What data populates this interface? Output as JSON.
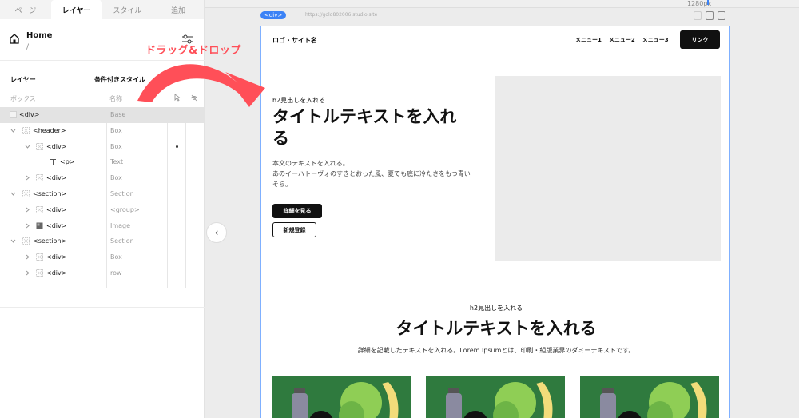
{
  "tabs": [
    {
      "label": "ページ",
      "active": false
    },
    {
      "label": "レイヤー",
      "active": true
    },
    {
      "label": "スタイル",
      "active": false
    },
    {
      "label": "追加",
      "active": false
    }
  ],
  "page": {
    "name": "Home",
    "path": "/"
  },
  "layers_panel": {
    "title": "レイヤー",
    "conditional_style": "条件付きスタイル",
    "column_box": "ボックス",
    "column_name": "名称"
  },
  "tree": [
    {
      "tag": "<div>",
      "type": "Base",
      "depth": 0,
      "selected": true,
      "chevron": false,
      "dot": false
    },
    {
      "tag": "<header>",
      "type": "Box",
      "depth": 1,
      "selected": false,
      "chevron": "down",
      "dot": false
    },
    {
      "tag": "<div>",
      "type": "Box",
      "depth": 2,
      "selected": false,
      "chevron": "down",
      "dot": true
    },
    {
      "tag": "<p>",
      "type": "Text",
      "depth": 3,
      "selected": false,
      "chevron": false,
      "dot": false,
      "text_node": true
    },
    {
      "tag": "<div>",
      "type": "Box",
      "depth": 2,
      "selected": false,
      "chevron": "right",
      "dot": false
    },
    {
      "tag": "<section>",
      "type": "Section",
      "depth": 1,
      "selected": false,
      "chevron": "down",
      "dot": false
    },
    {
      "tag": "<div>",
      "type": "<group>",
      "depth": 2,
      "selected": false,
      "chevron": "right",
      "dot": false
    },
    {
      "tag": "<div>",
      "type": "Image",
      "depth": 2,
      "selected": false,
      "chevron": "right",
      "dot": false,
      "image_node": true
    },
    {
      "tag": "<section>",
      "type": "Section",
      "depth": 1,
      "selected": false,
      "chevron": "down",
      "dot": false
    },
    {
      "tag": "<div>",
      "type": "Box",
      "depth": 2,
      "selected": false,
      "chevron": "right",
      "dot": false
    },
    {
      "tag": "<div>",
      "type": "row",
      "depth": 2,
      "selected": false,
      "chevron": "right",
      "dot": false
    }
  ],
  "annotation": {
    "drag_drop_label": "ドラッグ&ドロップ",
    "color": "#ff4f58"
  },
  "canvas": {
    "width_label": "1280px",
    "selected_badge": "<div>",
    "url": "https://gold802006.studio.site"
  },
  "site": {
    "logo": "ロゴ・サイト名",
    "nav": [
      "メニュー1",
      "メニュー2",
      "メニュー3"
    ],
    "nav_cta": "リンク",
    "hero": {
      "h2": "h2見出しを入れる",
      "title": "タイトルテキストを入れる",
      "body_line1": "本文のテキストを入れる。",
      "body_line2": "あのイーハトーヴォのすきとおった風、夏でも底に冷たさをもつ青いそら。",
      "primary_button": "詳細を見る",
      "secondary_button": "新規登録"
    },
    "section2": {
      "h2": "h2見出しを入れる",
      "title": "タイトルテキストを入れる",
      "body": "詳細を記載したテキストを入れる。Lorem Ipsumとは、印刷・組版業界のダミーテキストです。"
    }
  },
  "colors": {
    "accent": "#3b82f6",
    "primary_dark": "#111111",
    "card_green": "#2f7a3e"
  }
}
